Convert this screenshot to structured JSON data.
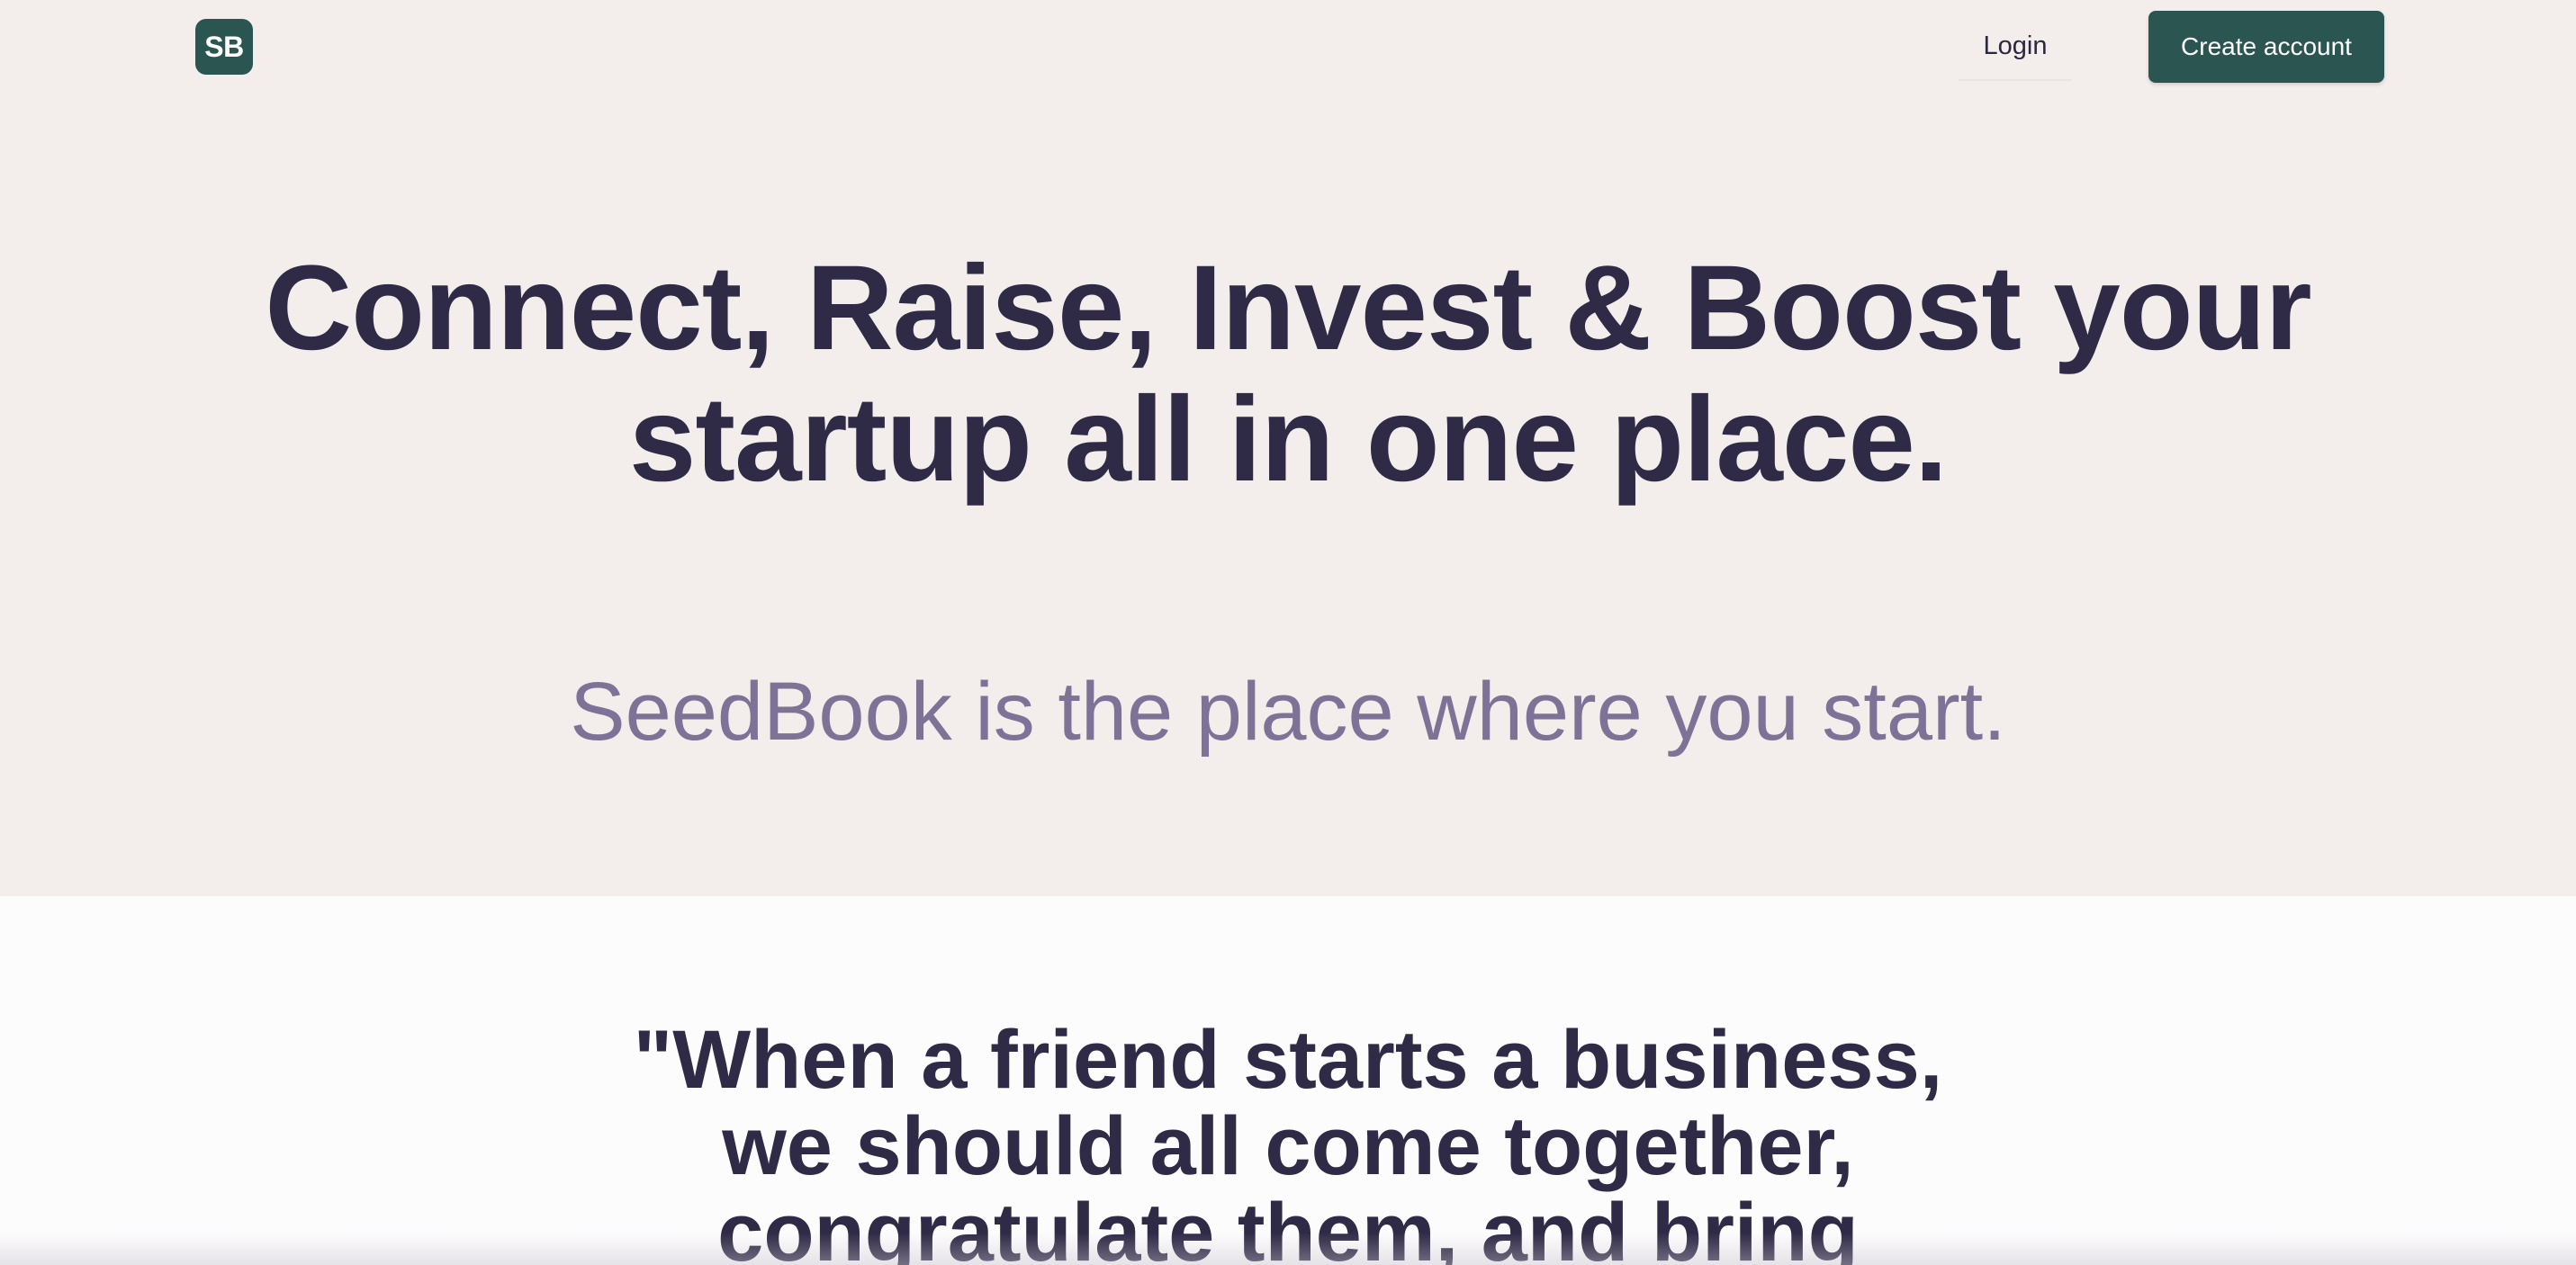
{
  "brand": {
    "logo_text": "SB",
    "accent_color": "#2a5551"
  },
  "nav": {
    "login_label": "Login",
    "create_account_label": "Create account"
  },
  "hero": {
    "headline_line1": "Connect, Raise, Invest & Boost your",
    "headline_line2": "startup all in one place.",
    "subheadline": "SeedBook is the place where you start.",
    "background_color": "#f3eeec"
  },
  "testimonial": {
    "quote_line1": "\"When a friend starts a business,",
    "quote_line2": "we should all come together,",
    "quote_line3": "congratulate them, and bring"
  }
}
